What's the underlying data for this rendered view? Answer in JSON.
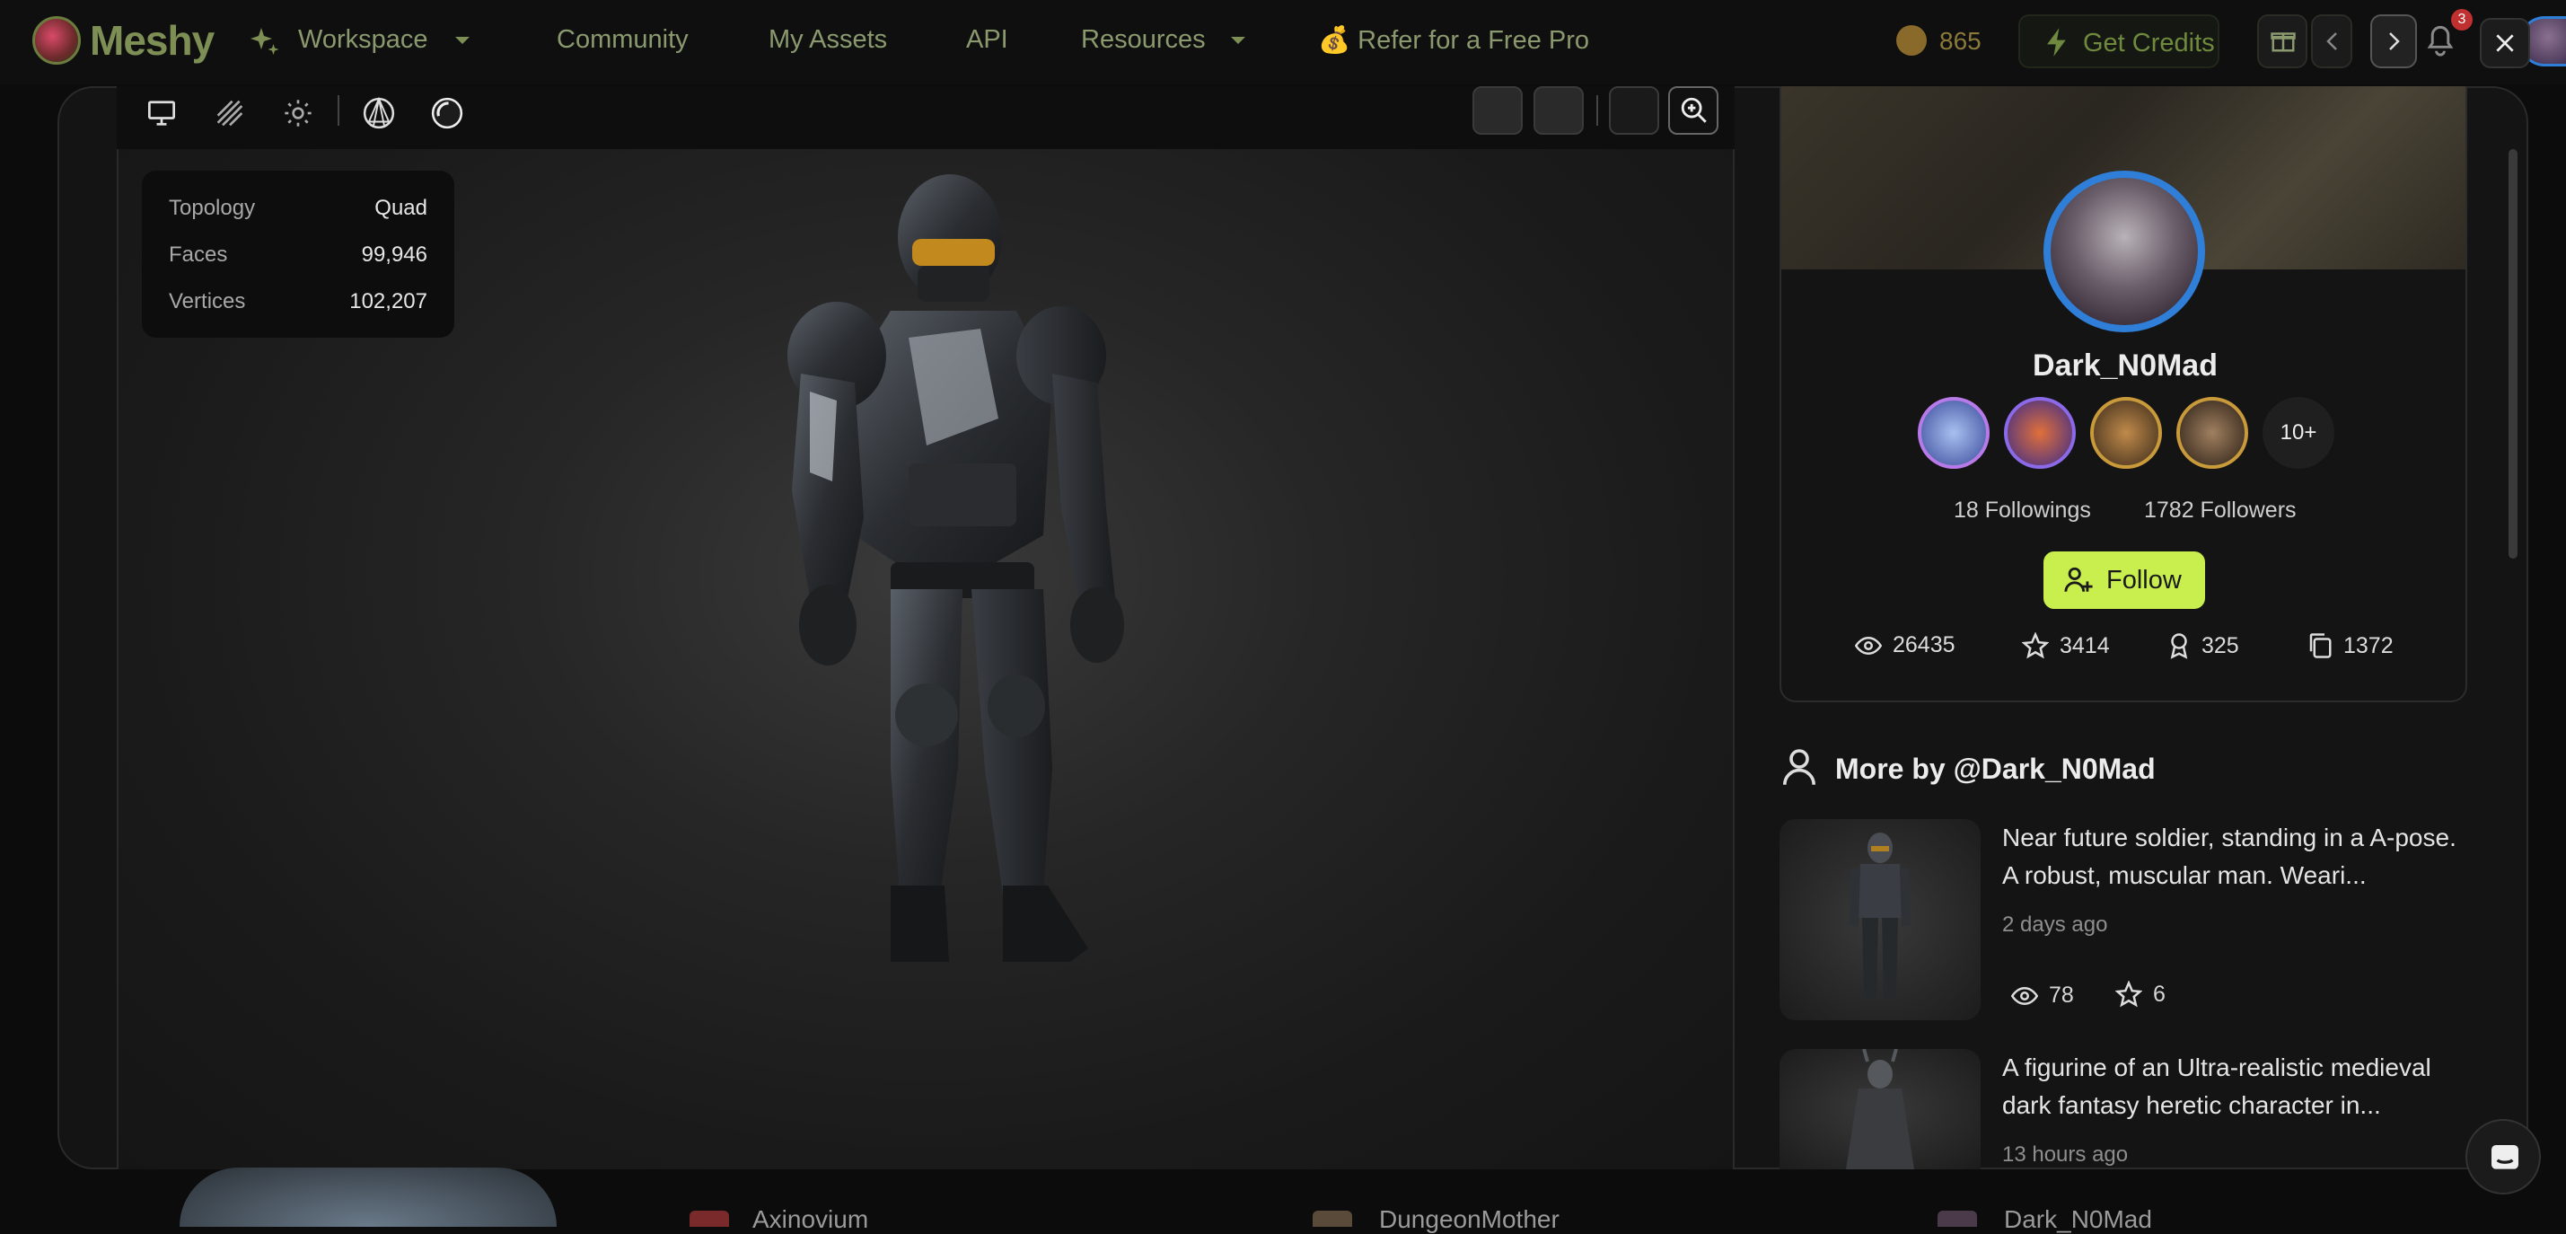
{
  "nav": {
    "brand": "Meshy",
    "workspace": "Workspace",
    "community": "Community",
    "my_assets": "My Assets",
    "api": "API",
    "resources": "Resources",
    "refer": "💰 Refer for a Free Pro",
    "credits": "865",
    "get_credits": "Get Credits",
    "notif_count": "3"
  },
  "viewer": {
    "stats": [
      {
        "label": "Topology",
        "value": "Quad"
      },
      {
        "label": "Faces",
        "value": "99,946"
      },
      {
        "label": "Vertices",
        "value": "102,207"
      }
    ]
  },
  "profile": {
    "username": "Dark_N0Mad",
    "badges_more": "10+",
    "followings": "18 Followings",
    "followers": "1782 Followers",
    "follow_label": "Follow",
    "metrics": {
      "views": "26435",
      "stars": "3414",
      "awards": "325",
      "copies": "1372"
    }
  },
  "more": {
    "title": "More by @Dark_N0Mad",
    "items": [
      {
        "title": "Near future soldier, standing in a A-pose. A robust, muscular man. Weari...",
        "time": "2 days ago",
        "views": "78",
        "stars": "6"
      },
      {
        "title": "A figurine of an Ultra-realistic medieval dark fantasy heretic character in...",
        "time": "13 hours ago"
      }
    ]
  },
  "background": {
    "user1": "Axinovium",
    "user2": "DungeonMother",
    "user3": "Dark_N0Mad"
  },
  "colors": {
    "accent": "#c9ef4f",
    "avatar_ring": "#2f7fd8"
  }
}
